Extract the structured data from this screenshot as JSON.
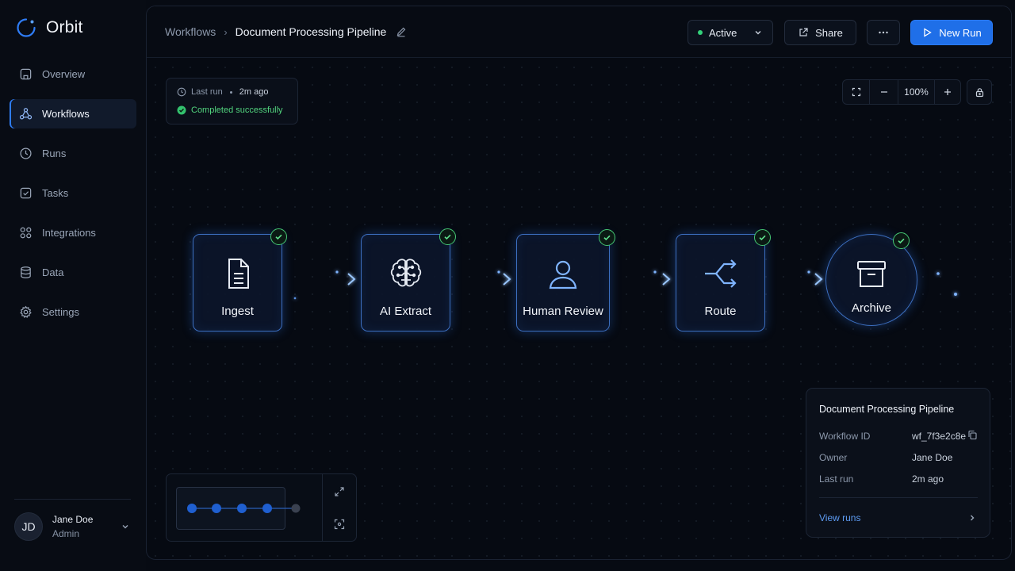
{
  "app": {
    "name": "Orbit"
  },
  "sidebar": {
    "items": [
      {
        "label": "Overview",
        "icon": "home-icon",
        "active": false
      },
      {
        "label": "Workflows",
        "icon": "workflow-icon",
        "active": true
      },
      {
        "label": "Runs",
        "icon": "history-icon",
        "active": false
      },
      {
        "label": "Tasks",
        "icon": "checkbox-icon",
        "active": false
      },
      {
        "label": "Integrations",
        "icon": "grid-icon",
        "active": false
      },
      {
        "label": "Data",
        "icon": "database-icon",
        "active": false
      },
      {
        "label": "Settings",
        "icon": "gear-icon",
        "active": false
      }
    ],
    "user": {
      "initials": "JD",
      "name": "Jane Doe",
      "role": "Admin"
    }
  },
  "header": {
    "breadcrumb_parent": "Workflows",
    "breadcrumb_current": "Document Processing Pipeline",
    "status_label": "Active",
    "share_label": "Share",
    "primary_label": "New Run"
  },
  "last_run": {
    "label": "Last run",
    "ago": "2m ago",
    "status": "Completed successfully"
  },
  "zoom": {
    "level": "100%"
  },
  "pipeline": {
    "nodes": [
      {
        "label": "Ingest",
        "icon": "document-icon",
        "completed": true
      },
      {
        "label": "AI Extract",
        "icon": "brain-icon",
        "completed": true
      },
      {
        "label": "Human Review",
        "icon": "user-icon",
        "completed": true
      },
      {
        "label": "Route",
        "icon": "route-split-icon",
        "completed": true
      },
      {
        "label": "Archive",
        "icon": "archive-box-icon",
        "completed": true
      }
    ]
  },
  "info_card": {
    "title": "Document Processing Pipeline",
    "rows": [
      {
        "key": "Workflow ID",
        "value": "wf_7f3e2c8e"
      },
      {
        "key": "Owner",
        "value": "Jane Doe"
      },
      {
        "key": "Last run",
        "value": "2m ago"
      }
    ],
    "link_label": "View runs"
  },
  "colors": {
    "accent": "#1f6fe8",
    "success": "#33d17a",
    "node_border": "#3c6fc0",
    "link": "#5d9bf2"
  }
}
